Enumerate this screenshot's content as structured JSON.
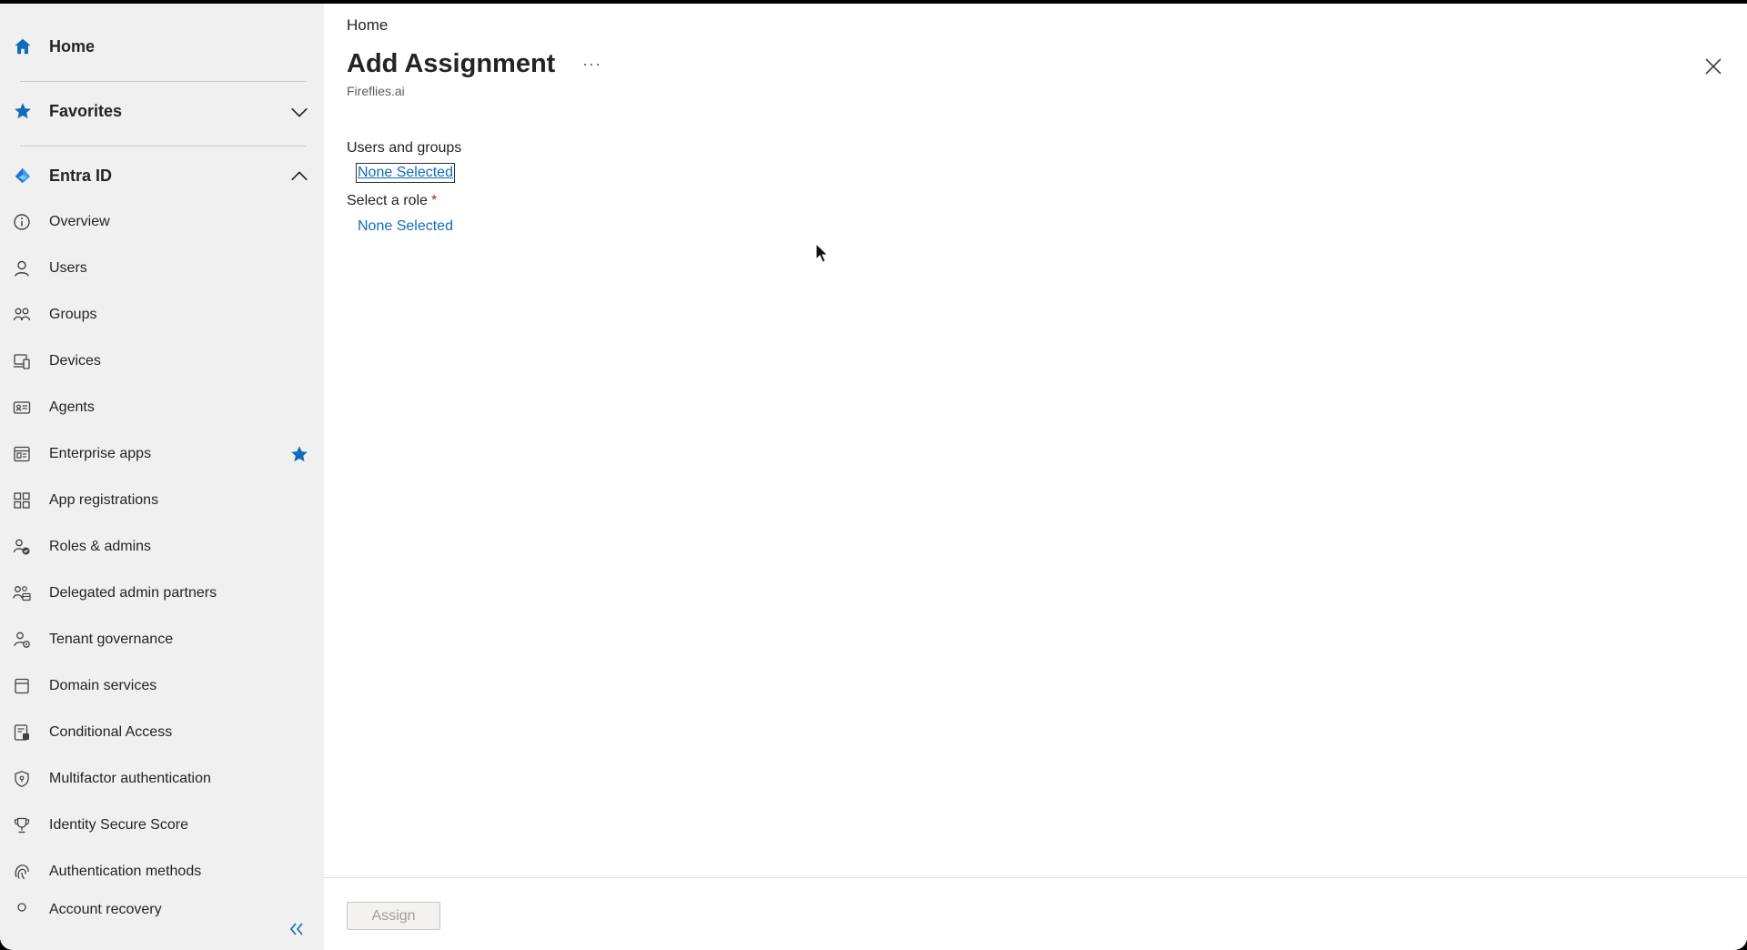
{
  "sidebar": {
    "home": {
      "label": "Home",
      "icon": "home-icon"
    },
    "favorites": {
      "label": "Favorites",
      "icon": "star-icon"
    },
    "entra": {
      "label": "Entra ID",
      "icon": "entra-id-icon"
    },
    "items": [
      {
        "label": "Overview",
        "icon": "info-icon"
      },
      {
        "label": "Users",
        "icon": "user-icon"
      },
      {
        "label": "Groups",
        "icon": "groups-icon"
      },
      {
        "label": "Devices",
        "icon": "devices-icon"
      },
      {
        "label": "Agents",
        "icon": "agent-card-icon"
      },
      {
        "label": "Enterprise apps",
        "icon": "enterprise-apps-icon",
        "favorite": true
      },
      {
        "label": "App registrations",
        "icon": "app-grid-icon"
      },
      {
        "label": "Roles & admins",
        "icon": "roles-icon"
      },
      {
        "label": "Delegated admin partners",
        "icon": "partners-icon"
      },
      {
        "label": "Tenant governance",
        "icon": "governance-icon"
      },
      {
        "label": "Domain services",
        "icon": "domain-icon"
      },
      {
        "label": "Conditional Access",
        "icon": "conditional-access-icon"
      },
      {
        "label": "Multifactor authentication",
        "icon": "shield-icon"
      },
      {
        "label": "Identity Secure Score",
        "icon": "trophy-icon"
      },
      {
        "label": "Authentication methods",
        "icon": "fingerprint-icon"
      },
      {
        "label": "Account recovery",
        "icon": "recovery-icon"
      }
    ]
  },
  "main": {
    "breadcrumb": "Home",
    "title": "Add Assignment",
    "more": "···",
    "subtitle": "Fireflies.ai",
    "users_groups": {
      "label": "Users and groups",
      "value": "None Selected"
    },
    "role": {
      "label": "Select a role",
      "required": "*",
      "value": "None Selected"
    },
    "assign_label": "Assign"
  },
  "colors": {
    "accent": "#0f6cbd",
    "sidebar_bg": "#f0f0f0",
    "required": "#a4262c"
  }
}
